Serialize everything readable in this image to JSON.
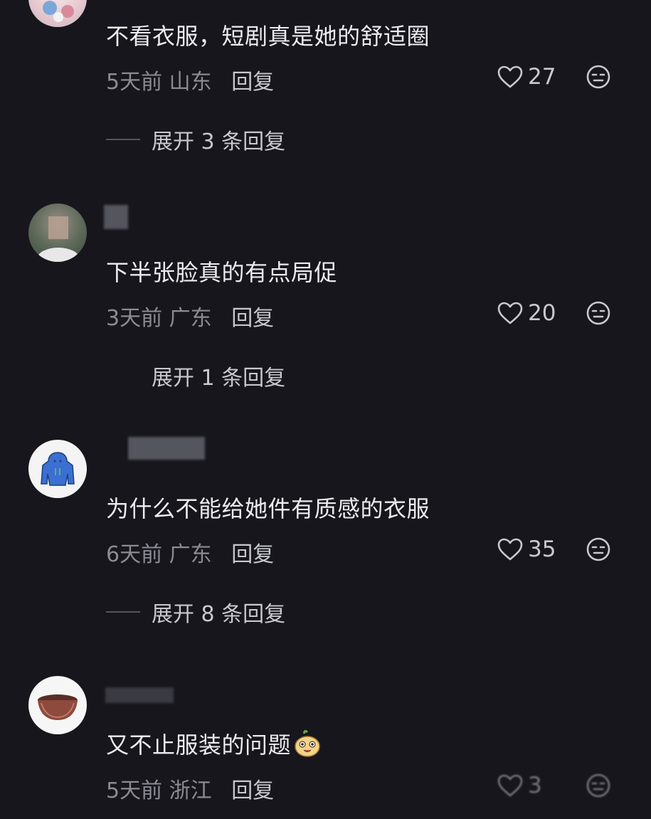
{
  "comments": [
    {
      "text": "不看衣服，短剧真是她的舒适圈",
      "time": "5天前",
      "location": "山东",
      "reply_label": "回复",
      "likes": "27",
      "expand_label": "展开 3 条回复"
    },
    {
      "text": "下半张脸真的有点局促",
      "time": "3天前",
      "location": "广东",
      "reply_label": "回复",
      "likes": "20",
      "expand_label": "展开 1 条回复"
    },
    {
      "text": "为什么不能给她件有质感的衣服",
      "time": "6天前",
      "location": "广东",
      "reply_label": "回复",
      "likes": "35",
      "expand_label": "展开 8 条回复"
    },
    {
      "text": "又不止服装的问题",
      "time": "5天前",
      "location": "浙江",
      "reply_label": "回复",
      "likes": "3",
      "expand_label": ""
    }
  ],
  "colors": {
    "background": "#17161c",
    "text": "#ececf0",
    "meta": "#8b8b93",
    "reply": "#c8c8cf"
  },
  "icons": [
    "heart-outline-icon",
    "dislike-face-icon",
    "emoji-face-icon"
  ]
}
